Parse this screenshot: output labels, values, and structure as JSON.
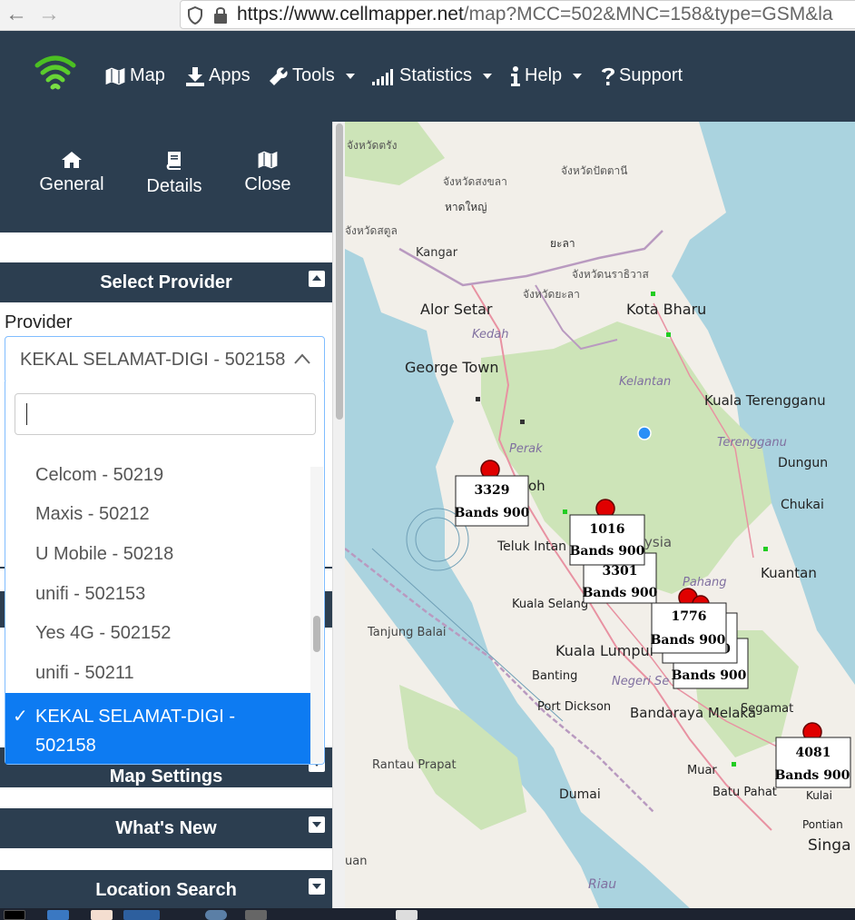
{
  "browser": {
    "url": "https://www.cellmapper.net/map?MCC=502&MNC=158&type=GSM&la",
    "url_host": "https://www.cellmapper.net",
    "url_path": "/map?MCC=502&MNC=158&type=GSM&la"
  },
  "nav": {
    "items": [
      {
        "label": "Map",
        "icon": "map-icon"
      },
      {
        "label": "Apps",
        "icon": "download-icon"
      },
      {
        "label": "Tools",
        "icon": "wrench-icon",
        "dropdown": true
      },
      {
        "label": "Statistics",
        "icon": "signal-bars-icon",
        "dropdown": true
      },
      {
        "label": "Help",
        "icon": "info-icon",
        "dropdown": true
      },
      {
        "label": "Support",
        "icon": "question-icon"
      }
    ]
  },
  "sidebar": {
    "tabs": [
      {
        "label": "General",
        "icon": "home-icon"
      },
      {
        "label": "Details",
        "icon": "book-icon"
      },
      {
        "label": "Close",
        "icon": "map-icon"
      }
    ],
    "panels": {
      "select_provider": "Select Provider",
      "map_settings": "Map Settings",
      "whats_new": "What's New",
      "location_search": "Location Search"
    },
    "provider_label": "Provider",
    "provider_selected": "KEKAL SELAMAT-DIGI - 502158",
    "search_value": "",
    "options": [
      "Celcom - 50219",
      "Maxis - 50212",
      "U Mobile - 50218",
      "unifi - 502153",
      "Yes 4G - 502152",
      "unifi - 50211"
    ],
    "selected_option_line1": "KEKAL SELAMAT-DIGI -",
    "selected_option_line2": "502158",
    "check_mark": "✓"
  },
  "map": {
    "places": {
      "p_changwat_trang": "จังหวัดตรัง",
      "p_pattani": "จังหวัดปัตตานี",
      "p_songkhla": "จังหวัดสงขลา",
      "p_hatyai": "หาดใหญ่",
      "p_satun": "จังหวัดสตูล",
      "p_yala_town": "ยะลา",
      "p_narathiwat": "จังหวัดนราธิวาส",
      "p_yala": "จังหวัดยะลา",
      "kangar": "Kangar",
      "alor_setar": "Alor Setar",
      "kedah": "Kedah",
      "kota_bharu": "Kota Bharu",
      "george_town": "George Town",
      "kelantan": "Kelantan",
      "kuala_terengganu": "Kuala Terengganu",
      "terengganu": "Terengganu",
      "perak": "Perak",
      "dungun": "Dungun",
      "ipoh_fragment": "oh",
      "chukai": "Chukai",
      "malaysia_fragment": "ysia",
      "teluk_intan": "Teluk Intan",
      "kuantan": "Kuantan",
      "pahang": "Pahang",
      "kuala_selangor": "Kuala Selang",
      "tanjung_balai": "Tanjung Balai",
      "kuala_lumpur": "Kuala Lumpur",
      "banting": "Banting",
      "negeri_sembilan": "Negeri Se",
      "port_dickson": "Port Dickson",
      "bandaraya_melaka": "Bandaraya Melaka",
      "segamat": "Segamat",
      "rantau_prapat": "Rantau Prapat",
      "muar": "Muar",
      "batu_pahat": "Batu Pahat",
      "kulai": "Kulai",
      "dumai": "Dumai",
      "pontian": "Pontian",
      "singapore_fragment": "Singa",
      "riau": "Riau",
      "uan": "uan"
    },
    "markers": [
      {
        "id": "3329",
        "bands": "Bands 900"
      },
      {
        "id": "1016",
        "bands": "Bands 900"
      },
      {
        "id": "3301",
        "bands": "Bands 900"
      },
      {
        "id": "1776",
        "bands": "Bands 900"
      },
      {
        "id": "0",
        "bands": "Bands 900"
      },
      {
        "id": "",
        "bands": "Bands 900"
      },
      {
        "id": "4081",
        "bands": "Bands 900"
      }
    ]
  },
  "colors": {
    "navbar": "#2c3e50",
    "selected": "#0d7bf2",
    "water": "#aad3df",
    "land": "#f2efe9",
    "forest": "#cde4b8",
    "marker": "#e00000"
  }
}
